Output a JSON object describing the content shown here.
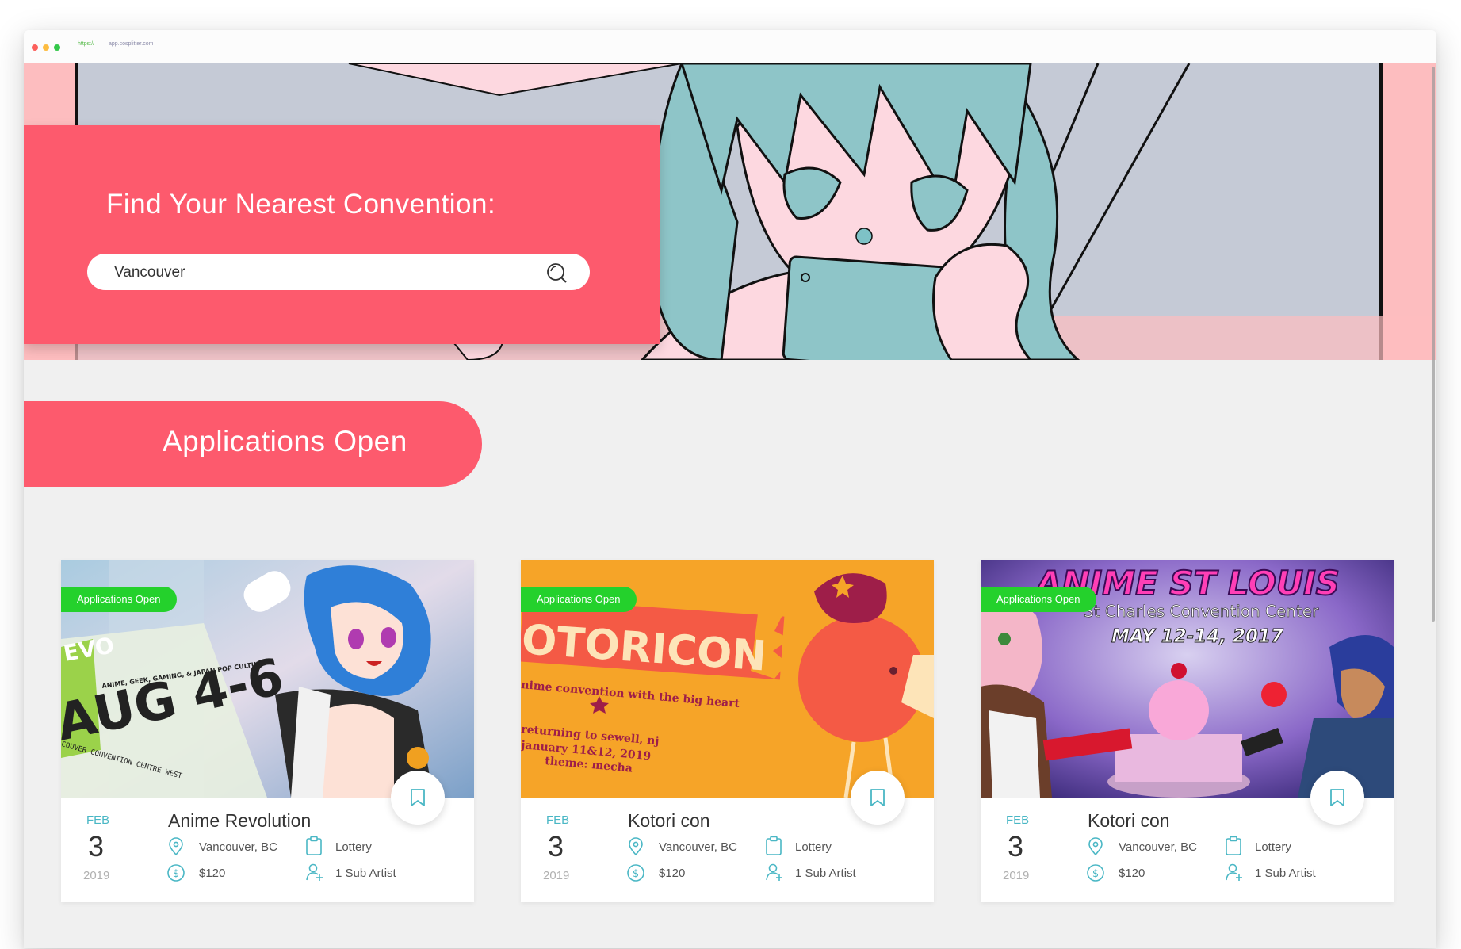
{
  "browser": {
    "protocol": "https://",
    "host": "app.cosplitter.com",
    "traffic_lights": [
      "#fc605c",
      "#fdbc40",
      "#34c84a"
    ]
  },
  "hero": {
    "title": "Find Your Nearest Convention:",
    "search": {
      "value": "Vancouver"
    }
  },
  "section": {
    "title": "Applications Open"
  },
  "colors": {
    "accent": "#fd5a6d",
    "teal": "#4ab7c5",
    "badge": "#24d12c"
  },
  "cards": [
    {
      "badge": "Applications Open",
      "month": "FEB",
      "day": "3",
      "year": "2019",
      "name": "Anime Revolution",
      "location": "Vancouver, BC",
      "type": "Lottery",
      "price": "$120",
      "artists": "1 Sub Artist"
    },
    {
      "badge": "Applications Open",
      "month": "FEB",
      "day": "3",
      "year": "2019",
      "name": "Kotori con",
      "location": "Vancouver, BC",
      "type": "Lottery",
      "price": "$120",
      "artists": "1 Sub Artist"
    },
    {
      "badge": "Applications Open",
      "month": "FEB",
      "day": "3",
      "year": "2019",
      "name": "Kotori con",
      "location": "Vancouver, BC",
      "type": "Lottery",
      "price": "$120",
      "artists": "1 Sub Artist"
    }
  ],
  "card_images": {
    "card1": {
      "lines": [
        "EVO",
        "AUG 4-6",
        "ANIME, GEEK, GAMING, & JAPAN POP CULTURE",
        "COUVER CONVENTION CENTRE WEST"
      ]
    },
    "card2": {
      "lines": [
        "OTORICON",
        "nime convention with the big heart",
        "returning to sewell, nj",
        "january 11&12, 2019",
        "theme: mecha"
      ]
    },
    "card3": {
      "lines": [
        "ANIME ST LOUIS",
        "St Charles Convention Center",
        "MAY 12-14, 2017"
      ]
    }
  },
  "icons": [
    "search-icon",
    "bookmark-icon",
    "location-pin-icon",
    "clipboard-icon",
    "dollar-icon",
    "user-add-icon"
  ]
}
